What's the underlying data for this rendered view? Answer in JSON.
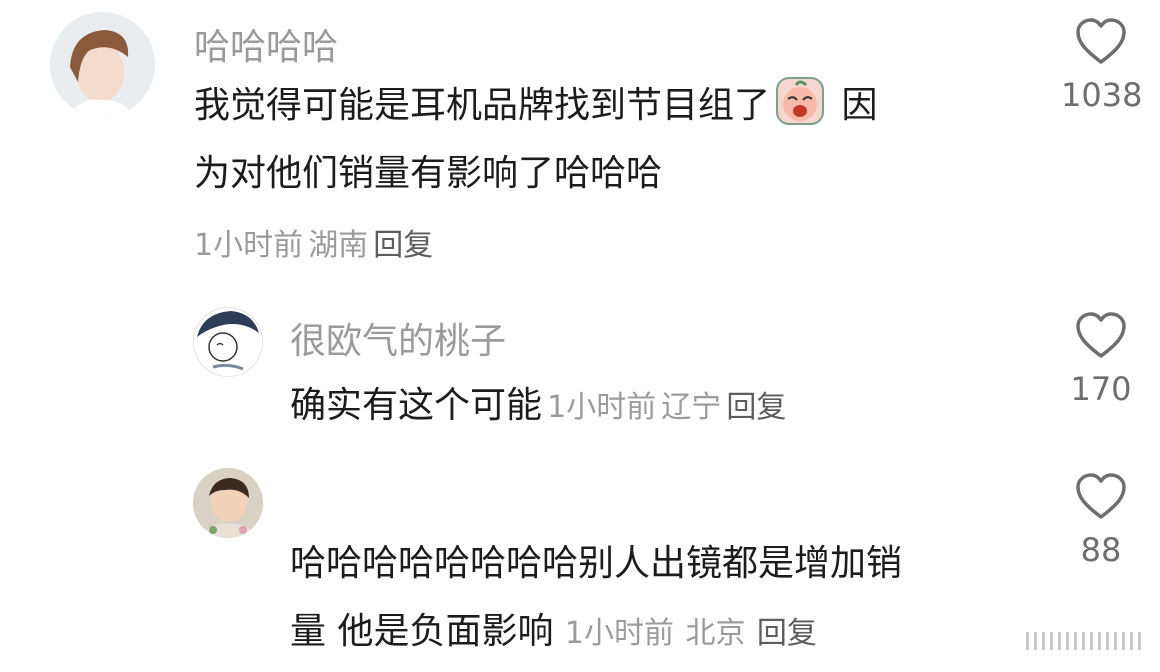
{
  "comments": [
    {
      "username": "哈哈哈哈",
      "text_before_emoji": "我觉得可能是耳机品牌找到节目组了",
      "emoji": "crying-face-emoji",
      "text_after_emoji": " 因",
      "text_line2": "为对他们销量有影响了哈哈哈",
      "time": "1小时前",
      "location": "湖南",
      "reply_label": "回复",
      "likes": "1038"
    },
    {
      "username": "很欧气的桃子",
      "text": "确实有这个可能",
      "time": "1小时前",
      "location": "辽宁",
      "reply_label": "回复",
      "likes": "170"
    },
    {
      "text_line1": "哈哈哈哈哈哈哈哈别人出镜都是增加销",
      "text_line2": "量 他是负面影响",
      "time": "1小时前",
      "location": "北京",
      "reply_label": "回复",
      "likes": "88"
    }
  ],
  "icons": {
    "like": "heart-outline-icon"
  },
  "colors": {
    "username": "#9a9a9a",
    "text": "#1c1c1c",
    "meta": "#9b9b9b"
  }
}
